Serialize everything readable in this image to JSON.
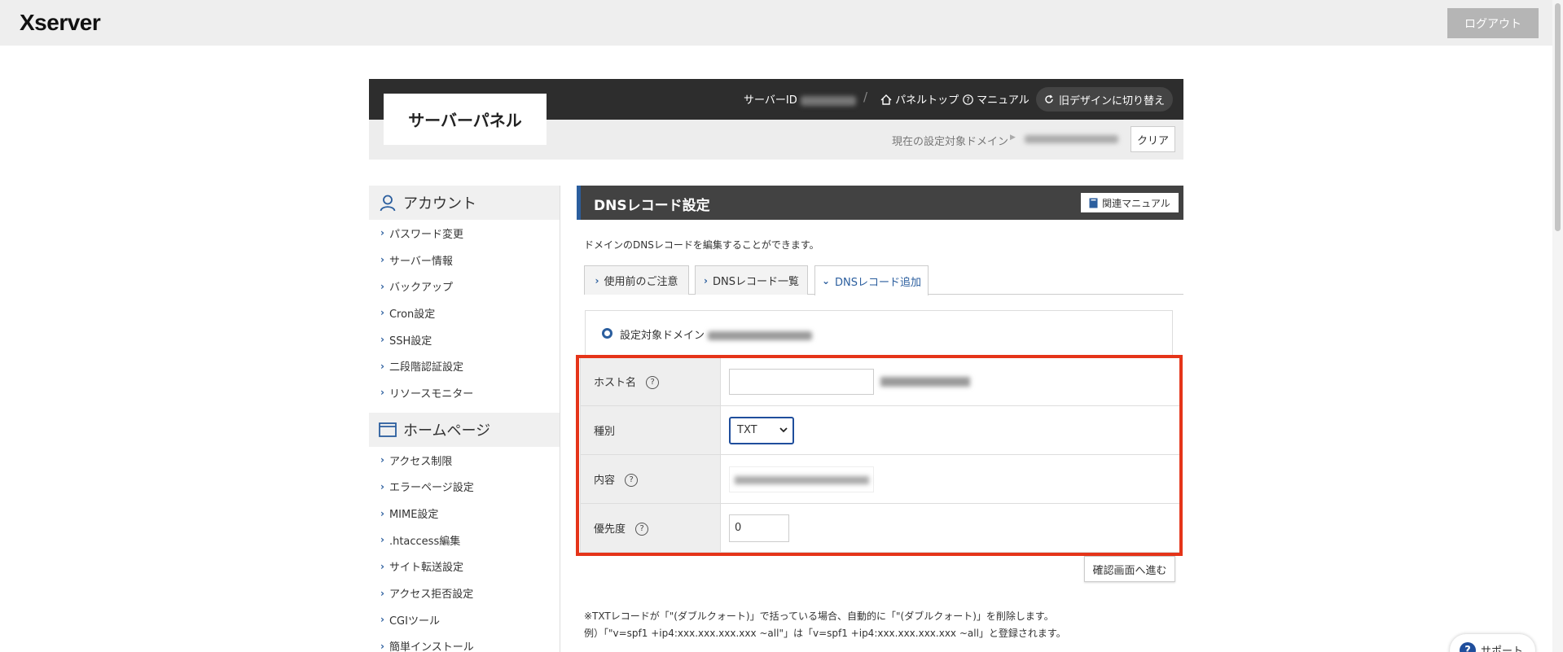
{
  "topbar": {
    "logo": "Xserver",
    "logout": "ログアウト"
  },
  "panel": {
    "title": "サーバーパネル",
    "server_id_label": "サーバーID",
    "panel_top": "パネルトップ",
    "manual": "マニュアル",
    "old_design": "旧デザインに切り替え",
    "current_domain_label": "現在の設定対象ドメイン",
    "clear": "クリア"
  },
  "sidebar": {
    "sections": [
      {
        "title": "アカウント",
        "icon": "user-icon",
        "items": [
          "パスワード変更",
          "サーバー情報",
          "バックアップ",
          "Cron設定",
          "SSH設定",
          "二段階認証設定",
          "リソースモニター"
        ]
      },
      {
        "title": "ホームページ",
        "icon": "window-icon",
        "items": [
          "アクセス制限",
          "エラーページ設定",
          "MIME設定",
          ".htaccess編集",
          "サイト転送設定",
          "アクセス拒否設定",
          "CGIツール",
          "簡単インストール"
        ]
      }
    ]
  },
  "content": {
    "title": "DNSレコード設定",
    "manual_btn": "関連マニュアル",
    "description": "ドメインのDNSレコードを編集することができます。",
    "tabs": [
      "使用前のご注意",
      "DNSレコード一覧",
      "DNSレコード追加"
    ],
    "active_tab": "DNSレコード追加",
    "domain_label": "設定対象ドメイン",
    "form": {
      "host_label": "ホスト名",
      "type_label": "種別",
      "type_value": "TXT",
      "content_label": "内容",
      "priority_label": "優先度",
      "priority_value": "0"
    },
    "confirm_btn": "確認画面へ進む",
    "note1": "※TXTレコードが「\"(ダブルクォート)」で括っている場合、自動的に「\"(ダブルクォート)」を削除します。",
    "note2": "例）「\"v=spf1 +ip4:xxx.xxx.xxx.xxx ~all\"」は「v=spf1 +ip4:xxx.xxx.xxx.xxx ~all」と登録されます。"
  },
  "support": "サポート",
  "colors": {
    "accent": "#2b5e9e",
    "highlight": "#e53419",
    "header_dark": "#2d2d2d"
  }
}
